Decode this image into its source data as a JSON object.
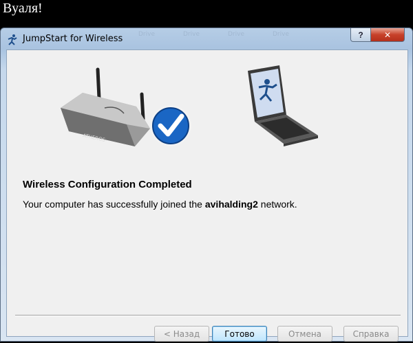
{
  "caption": "Вуаля!",
  "window": {
    "title": "JumpStart for Wireless",
    "help_label": "?",
    "close_label": "✕",
    "ghost_labels": [
      "Drive",
      "Drive",
      "Drive",
      "Drive"
    ]
  },
  "content": {
    "heading": "Wireless Configuration Completed",
    "message_prefix": "Your computer has successfully joined the ",
    "network_name": "avihalding2",
    "message_suffix": " network.",
    "router_brand": "ATHEROS"
  },
  "buttons": {
    "back": "< Назад",
    "finish": "Готово",
    "cancel": "Отмена",
    "help": "Справка"
  },
  "colors": {
    "check_badge": "#1a66c4",
    "close_button": "#c7412a",
    "title_gradient": "#a9c3e0"
  },
  "icons": {
    "title": "jumpstart-runner-icon",
    "success": "checkmark-icon"
  }
}
